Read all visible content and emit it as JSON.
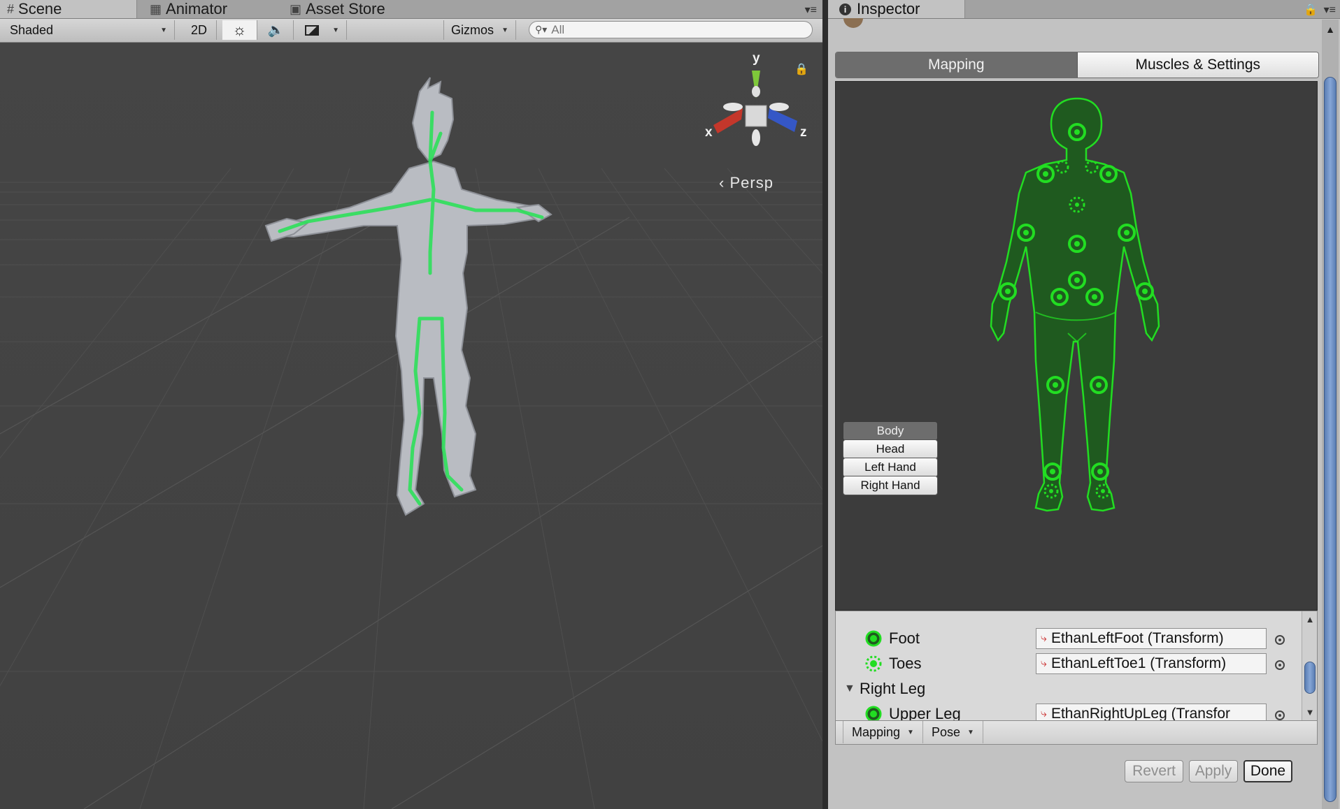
{
  "scene_window": {
    "tabs": [
      {
        "label": "Scene",
        "icon": "grid-icon",
        "active": true
      },
      {
        "label": "Animator",
        "icon": "animator-icon",
        "active": false
      },
      {
        "label": "Asset Store",
        "icon": "store-icon",
        "active": false
      }
    ],
    "toolbar": {
      "draw_mode": "Shaded",
      "mode_2d": "2D",
      "gizmos": "Gizmos",
      "search_placeholder": "All"
    },
    "view": {
      "projection_label": "Persp",
      "axis_x": "x",
      "axis_y": "y",
      "axis_z": "z"
    }
  },
  "inspector": {
    "tab_label": "Inspector",
    "mode_tabs": [
      "Mapping",
      "Muscles & Settings"
    ],
    "active_mode": "Mapping",
    "body_part_buttons": [
      "Body",
      "Head",
      "Left Hand",
      "Right Hand"
    ],
    "active_body_part": "Body",
    "bone_list": [
      {
        "name": "Foot",
        "value": "EthanLeftFoot (Transform)",
        "required": true
      },
      {
        "name": "Toes",
        "value": "EthanLeftToe1 (Transform)",
        "required": false
      },
      {
        "group": "Right Leg"
      },
      {
        "name": "Upper Leg",
        "value": "EthanRightUpLeg (Transfor",
        "required": true
      }
    ],
    "bottom_toolbar": {
      "mapping": "Mapping",
      "pose": "Pose"
    },
    "buttons": {
      "revert": "Revert",
      "apply": "Apply",
      "done": "Done"
    },
    "colors": {
      "bone_mapped": "#22dd22",
      "avatar_fill": "#1f5a1f",
      "scrollbar_thumb": "#6e91c6"
    }
  }
}
